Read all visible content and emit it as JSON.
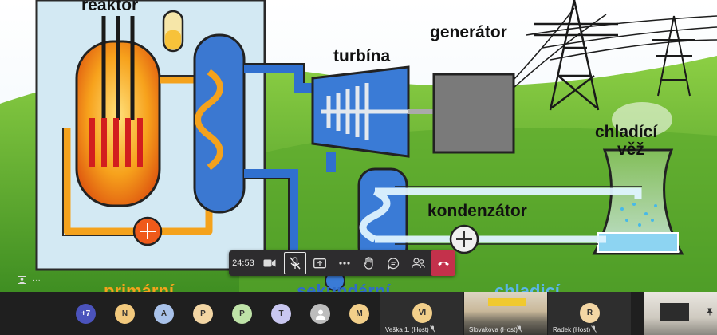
{
  "diagram": {
    "labels": {
      "reactor": "reaktor",
      "turbine": "turbína",
      "generator": "generátor",
      "cooling_tower_line1": "chladící",
      "cooling_tower_line2": "věž",
      "condenser": "kondenzátor"
    },
    "bottom_partial": {
      "left": "primární",
      "middle": "sekundární",
      "right": "chladicí"
    },
    "colors": {
      "pipe": "#f4a21c",
      "water_blue": "#2f6bc9",
      "vessel": "#cfe6f2",
      "grass": "#7cc23a",
      "generator": "#7a7a7a"
    }
  },
  "toolbar": {
    "timer": "24:53",
    "buttons": [
      {
        "name": "camera-button",
        "icon": "camera-icon"
      },
      {
        "name": "mic-button",
        "icon": "mic-off-icon"
      },
      {
        "name": "share-button",
        "icon": "share-screen-icon"
      },
      {
        "name": "more-button",
        "icon": "more-icon"
      },
      {
        "name": "raise-hand-button",
        "icon": "hand-icon"
      },
      {
        "name": "chat-button",
        "icon": "chat-icon"
      },
      {
        "name": "participants-button",
        "icon": "people-icon"
      },
      {
        "name": "hangup-button",
        "icon": "phone-hangup-icon"
      }
    ]
  },
  "self_view": {
    "more_label": "···"
  },
  "participants": {
    "overflow_count": "+7",
    "avatars": [
      {
        "initials": "N",
        "color": "#f2c97d"
      },
      {
        "initials": "A",
        "color": "#a9c2ea"
      },
      {
        "initials": "P",
        "color": "#f3d6a4"
      },
      {
        "initials": "P",
        "color": "#bfe3a8"
      },
      {
        "initials": "T",
        "color": "#c9c7f0"
      },
      {
        "initials": "",
        "color": "#bdbdbd"
      },
      {
        "initials": "M",
        "color": "#f2cf8a"
      }
    ],
    "tiles": [
      {
        "initials": "VI",
        "name": "Veška 1. (Host)"
      },
      {
        "initials": "",
        "name": "Slovakova (Host)"
      },
      {
        "initials": "R",
        "name": "Radek (Host)"
      },
      {
        "initials": "",
        "name": ""
      }
    ]
  }
}
